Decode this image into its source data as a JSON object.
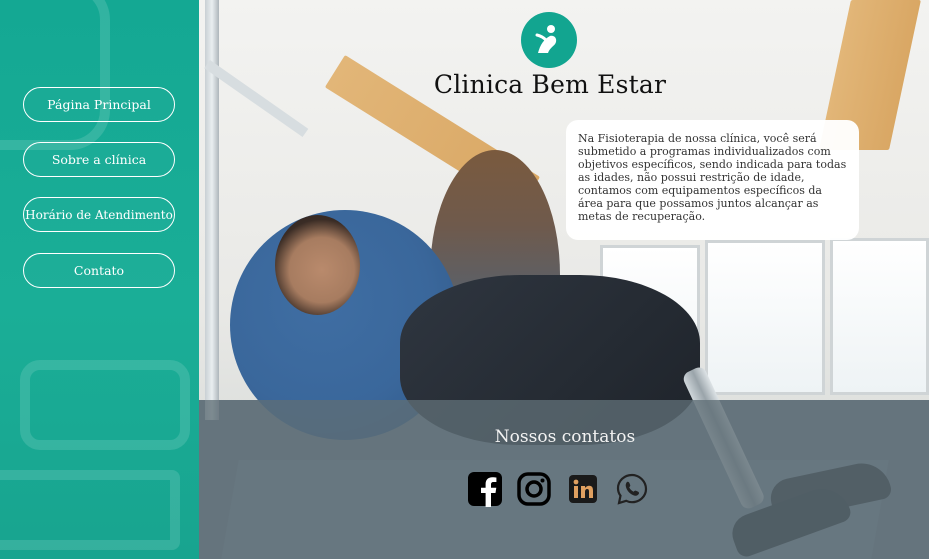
{
  "brand": {
    "title": "Clinica Bem Estar",
    "logo_icon": "physio-person-icon",
    "accent_color": "#14a893"
  },
  "nav": {
    "items": [
      {
        "label": "Página Principal",
        "icon": null
      },
      {
        "label": "Sobre a clínica",
        "icon": null
      },
      {
        "label": "Horário de Atendimento",
        "icon": null
      },
      {
        "label": "Contato",
        "icon": null
      }
    ]
  },
  "info": {
    "text": "Na Fisioterapia de nossa clínica, você será submetido a programas individualizados com objetivos específicos, sendo indicada para todas as idades, não possui restrição de idade, contamos com equipamentos específicos da área para que possamos juntos alcançar as metas de recuperação."
  },
  "contacts": {
    "title": "Nossos contatos",
    "social": [
      {
        "icon": "facebook-icon"
      },
      {
        "icon": "instagram-icon"
      },
      {
        "icon": "linkedin-icon"
      },
      {
        "icon": "whatsapp-icon"
      }
    ]
  }
}
